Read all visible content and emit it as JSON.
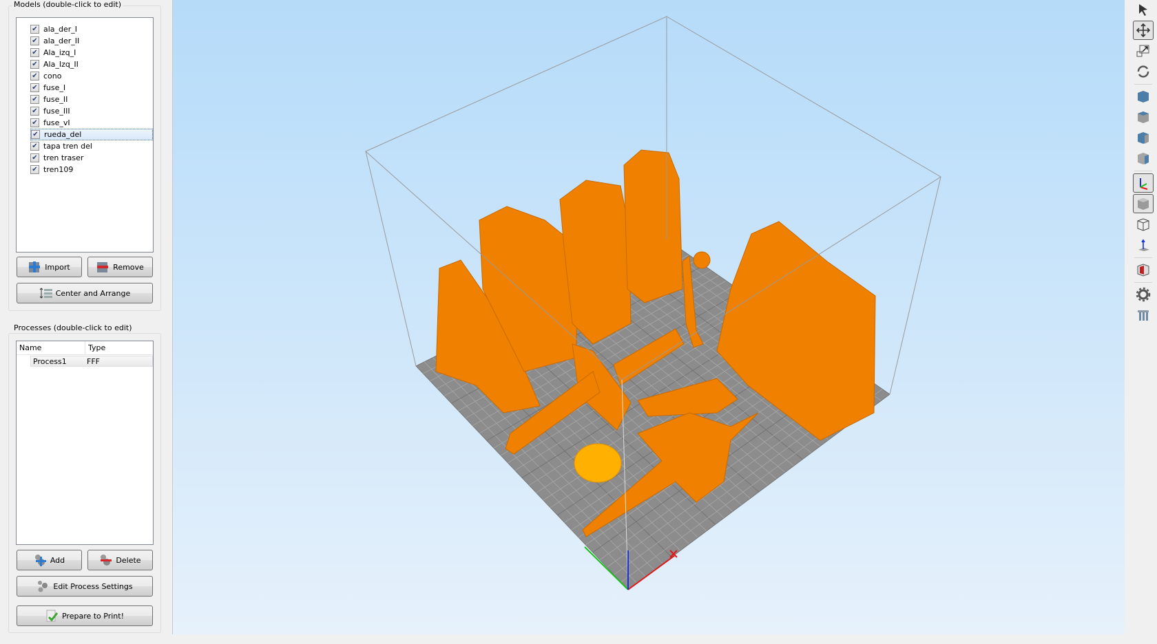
{
  "models_panel": {
    "title": "Models (double-click to edit)",
    "items": [
      {
        "label": "ala_der_I",
        "checked": true
      },
      {
        "label": "ala_der_II",
        "checked": true
      },
      {
        "label": "Ala_izq_I",
        "checked": true
      },
      {
        "label": "Ala_Izq_II",
        "checked": true
      },
      {
        "label": "cono",
        "checked": true
      },
      {
        "label": "fuse_I",
        "checked": true
      },
      {
        "label": "fuse_II",
        "checked": true
      },
      {
        "label": "fuse_III",
        "checked": true
      },
      {
        "label": "fuse_vI",
        "checked": true
      },
      {
        "label": "rueda_del",
        "checked": true,
        "selected": true
      },
      {
        "label": "tapa tren del",
        "checked": true
      },
      {
        "label": "tren traser",
        "checked": true
      },
      {
        "label": "tren109",
        "checked": true
      }
    ],
    "import_label": "Import",
    "remove_label": "Remove",
    "center_arrange_label": "Center and Arrange"
  },
  "processes_panel": {
    "title": "Processes (double-click to edit)",
    "columns": [
      "Name",
      "Type"
    ],
    "rows": [
      {
        "name": "Process1",
        "type": "FFF"
      }
    ],
    "add_label": "Add",
    "delete_label": "Delete",
    "edit_label": "Edit Process Settings",
    "prepare_label": "Prepare to Print!"
  },
  "colors": {
    "model": "#f08000",
    "accent": "#3a6ea5"
  },
  "toolbar": [
    "select-icon",
    "move-icon",
    "scale-icon",
    "rotate-icon",
    "view-top-icon",
    "view-front-icon",
    "view-left-icon",
    "view-right-icon",
    "axes-icon",
    "solid-view-icon",
    "wireframe-icon",
    "up-axis-icon",
    "section-view-icon",
    "settings-icon",
    "supports-icon"
  ]
}
